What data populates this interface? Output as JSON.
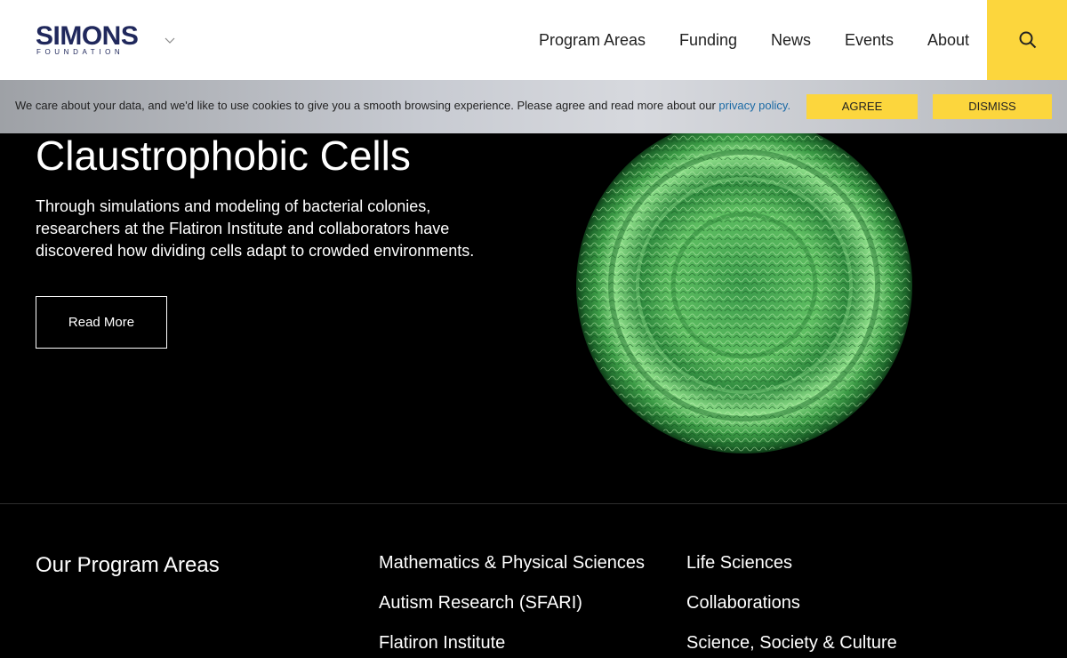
{
  "header": {
    "logo": {
      "word": "SIMONS",
      "sub": "FOUNDATION"
    },
    "nav": [
      "Program Areas",
      "Funding",
      "News",
      "Events",
      "About"
    ],
    "search_icon": "search-icon",
    "menu_icon": "chevron-down-icon"
  },
  "cookie_bar": {
    "text": "We care about your data, and we'd like to use cookies to give you a smooth browsing experience. Please agree and read more about our ",
    "link": "privacy policy.",
    "agree": "AGREE",
    "dismiss": "DISMISS"
  },
  "hero": {
    "title": "Claustrophobic Cells",
    "description": "Through simulations and modeling of bacterial colonies, researchers at the Flatiron Institute and collaborators have discovered how dividing cells adapt to crowded environments.",
    "button": "Read More"
  },
  "program_areas": {
    "heading": "Our Program Areas",
    "column1": [
      "Mathematics & Physical Sciences",
      "Autism Research (SFARI)",
      "Flatiron Institute"
    ],
    "column2": [
      "Life Sciences",
      "Collaborations",
      "Science, Society & Culture"
    ]
  },
  "colors": {
    "brand_navy": "#20285c",
    "accent_yellow": "#fcd63d",
    "link_blue": "#1b6aa5",
    "background": "#000000"
  }
}
